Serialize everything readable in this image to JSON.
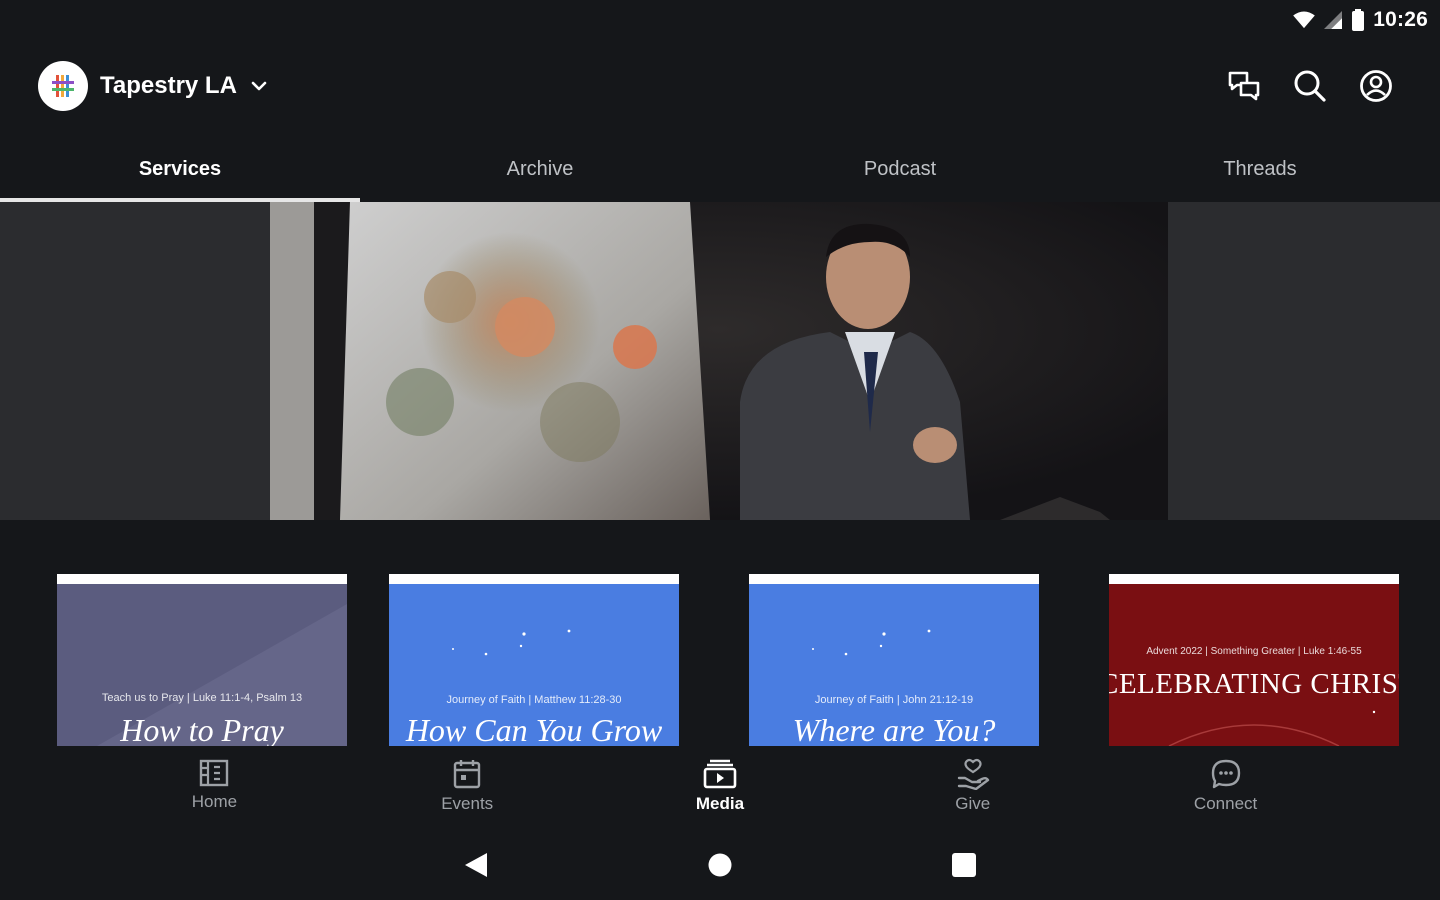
{
  "status": {
    "time": "10:26"
  },
  "app_bar": {
    "org_name": "Tapestry LA"
  },
  "tabs": [
    {
      "label": "Services",
      "active": true
    },
    {
      "label": "Archive",
      "active": false
    },
    {
      "label": "Podcast",
      "active": false
    },
    {
      "label": "Threads",
      "active": false
    }
  ],
  "thumbnails": [
    {
      "meta": "Teach us to Pray  |  Luke 11:1-4, Psalm 13",
      "title": "How to Pray",
      "bg": "#5b5c7f"
    },
    {
      "meta": "Journey of Faith  |  Matthew 11:28-30",
      "title": "How Can You Grow",
      "bg": "#4a7de1"
    },
    {
      "meta": "Journey of Faith  |  John 21:12-19",
      "title": "Where are You?",
      "bg": "#4a7de1"
    },
    {
      "meta": "Advent 2022  |  Something Greater  |  Luke 1:46-55",
      "title": "CELEBRATING CHRISTMAS",
      "bg": "#7a0f12"
    }
  ],
  "bottom_nav": [
    {
      "label": "Home",
      "icon": "building-icon",
      "active": false
    },
    {
      "label": "Events",
      "icon": "calendar-icon",
      "active": false
    },
    {
      "label": "Media",
      "icon": "media-icon",
      "active": true
    },
    {
      "label": "Give",
      "icon": "give-icon",
      "active": false
    },
    {
      "label": "Connect",
      "icon": "chat-bubble-icon",
      "active": false
    }
  ],
  "colors": {
    "background": "#15171a",
    "tab_indicator": "#e6e6e6",
    "nav_inactive": "#9da1a6"
  }
}
